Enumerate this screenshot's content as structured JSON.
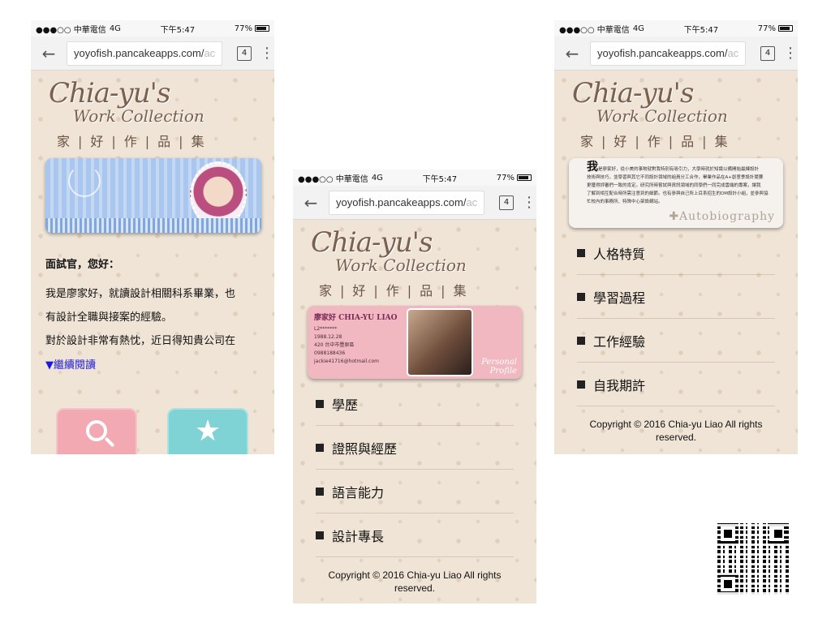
{
  "status": {
    "carrier": "●●●○○ 中華電信",
    "network": "4G",
    "time": "下午5:47",
    "battery": "77%"
  },
  "browser": {
    "url": "yoyofish.pancakeapps.com/",
    "url_fade": "ac",
    "tab_count": "4"
  },
  "logo": {
    "line1": "Chia-yu's",
    "line2": "Work Collection",
    "line3": "家|好|作|品|集"
  },
  "home": {
    "greeting": "面試官，您好：",
    "para_line1": "我是廖家好，就讀設計相關科系畢業，也",
    "para_line2": "有設計全職與接案的經驗。",
    "para_line3": "對於設計非常有熱忱，近日得知貴公司在",
    "read_more": "▼繼續閱讀"
  },
  "profile": {
    "card_name": "廖家好  CHIA-YU LIAO",
    "card_lines": [
      "L2*******",
      "1988.12.28",
      "420 台中市豐原區",
      "0988188436",
      "jackie41716@hotmail.com"
    ],
    "card_tag_line1": "Personal",
    "card_tag_line2": "Profile",
    "menu": [
      "學歷",
      "證照與經歷",
      "語言能力",
      "設計專長"
    ]
  },
  "about": {
    "intro_big": "我",
    "intro_line1": "是廖家好，從小美的事物就對我特別有吸引力，大學時就於知識以備開始最練設計",
    "intro_line2": "技術與技巧，並學習與其它不同設計領域的組員分工合作，畢業作品在A+創意季設計競賽",
    "intro_line3": "更獲得評審們一致的肯定。研究所時嘗試與資訊領域的同學們一同完成雲端的專案，讓我",
    "intro_line4": "了解到相互配合時所需注意到的細節。也有參與自己所上目系招生的DM設計小組，並參與協",
    "intro_line5": "忙校內的事務所、特殊中心架設網站。",
    "title": "✚Autobiography",
    "menu": [
      "人格特質",
      "學習過程",
      "工作經驗",
      "自我期許"
    ]
  },
  "footer": {
    "copyright_line1": "Copyright © 2016 Chia-yu Liao All rights",
    "copyright_line2": "reserved."
  }
}
